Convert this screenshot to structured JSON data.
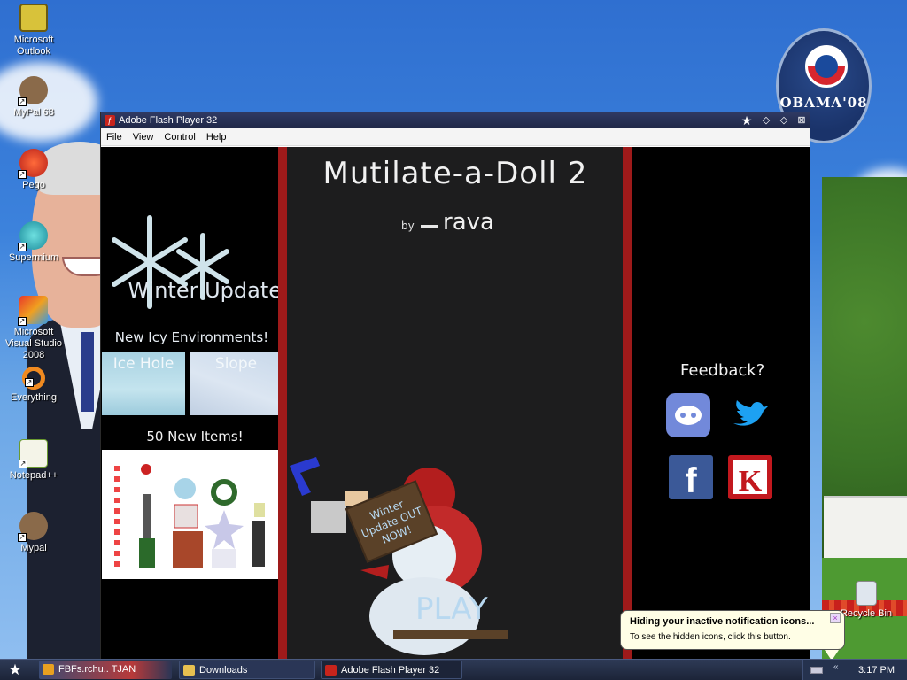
{
  "desktop": {
    "icons": [
      {
        "label": "Microsoft Outlook",
        "icon": "outlook-icon"
      },
      {
        "label": "MyPal 68",
        "icon": "raccoon-icon"
      },
      {
        "label": "Pego",
        "icon": "pego-icon"
      },
      {
        "label": "Supermium",
        "icon": "supermium-icon"
      },
      {
        "label": "Microsoft Visual Studio 2008",
        "icon": "visual-studio-icon"
      },
      {
        "label": "Everything",
        "icon": "everything-icon"
      },
      {
        "label": "Notepad++",
        "icon": "notepadpp-icon"
      },
      {
        "label": "Mypal",
        "icon": "raccoon-icon"
      }
    ],
    "recycle_bin_label": "Recycle Bin",
    "wallpaper_logo_text": "OBAMA'08"
  },
  "flash_window": {
    "title": "Adobe Flash Player 32",
    "menu": [
      "File",
      "View",
      "Control",
      "Help"
    ]
  },
  "game": {
    "title": "Mutilate-a-Doll 2",
    "by": "by",
    "author": "rava",
    "left": {
      "winter_update": "Winter Update",
      "new_envs": "New Icy Environments!",
      "env1": "Ice Hole",
      "env2": "Slope",
      "new_items": "50 New Items!"
    },
    "sign_text": "Winter Update OUT NOW!",
    "play": "PLAY",
    "right": {
      "feedback": "Feedback?",
      "socials": [
        "discord-icon",
        "twitter-icon",
        "facebook-icon",
        "kongregate-icon"
      ]
    },
    "colors": {
      "red_bar": "#9e1a1a",
      "discord": "#7289da",
      "twitter": "#1da1f2",
      "facebook": "#3b5998",
      "kongregate": "#c2181e"
    }
  },
  "notification": {
    "title": "Hiding your inactive notification icons...",
    "body": "To see the hidden icons, click this button."
  },
  "taskbar": {
    "tasks": [
      "FBFs.rchu.. TJAN",
      "Downloads",
      "Adobe Flash Player 32"
    ],
    "clock": "3:17 PM"
  }
}
